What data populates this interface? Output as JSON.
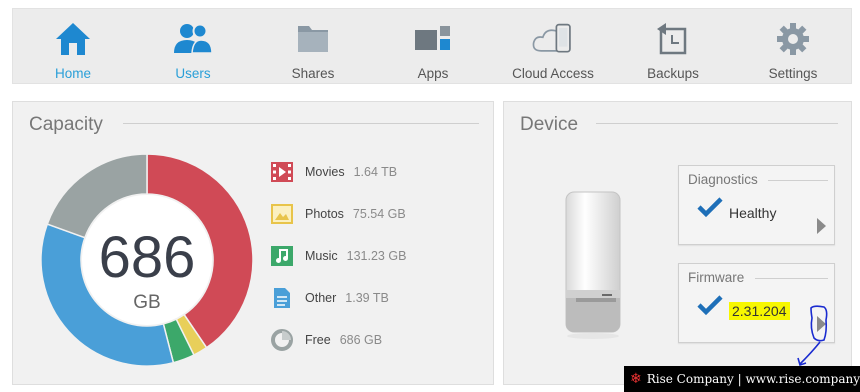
{
  "nav": {
    "items": [
      {
        "label": "Home",
        "icon": "home-icon",
        "active": true
      },
      {
        "label": "Users",
        "icon": "users-icon",
        "active": true
      },
      {
        "label": "Shares",
        "icon": "folder-icon",
        "active": false
      },
      {
        "label": "Apps",
        "icon": "apps-icon",
        "active": false
      },
      {
        "label": "Cloud Access",
        "icon": "cloud-device-icon",
        "active": false
      },
      {
        "label": "Backups",
        "icon": "backup-icon",
        "active": false
      },
      {
        "label": "Settings",
        "icon": "gear-icon",
        "active": false
      }
    ],
    "accent": "#2a9fd8"
  },
  "capacity": {
    "title": "Capacity",
    "total_value": "686",
    "total_unit": "GB",
    "legend": [
      {
        "name": "Movies",
        "value": "1.64 TB",
        "icon": "movie-icon",
        "color": "#d04a56"
      },
      {
        "name": "Photos",
        "value": "75.54 GB",
        "icon": "photo-icon",
        "color": "#e8c44a"
      },
      {
        "name": "Music",
        "value": "131.23 GB",
        "icon": "music-icon",
        "color": "#3ca86a"
      },
      {
        "name": "Other",
        "value": "1.39 TB",
        "icon": "document-icon",
        "color": "#4a9fd8"
      },
      {
        "name": "Free",
        "value": "686 GB",
        "icon": "pie-icon",
        "color": "#9aa3a3"
      }
    ],
    "donut_segments": [
      {
        "name": "Movies",
        "fraction": 0.405,
        "color": "#d04a56"
      },
      {
        "name": "Photos",
        "fraction": 0.022,
        "color": "#e8cf5a"
      },
      {
        "name": "Music",
        "fraction": 0.033,
        "color": "#3ca86a"
      },
      {
        "name": "Other",
        "fraction": 0.345,
        "color": "#4a9fd8"
      },
      {
        "name": "Free",
        "fraction": 0.195,
        "color": "#9aa3a3"
      }
    ]
  },
  "device": {
    "title": "Device",
    "diagnostics": {
      "title": "Diagnostics",
      "value": "Healthy"
    },
    "firmware": {
      "title": "Firmware",
      "value": "2.31.204"
    }
  },
  "watermark": {
    "text": "Rise Company | www.rise.company"
  }
}
